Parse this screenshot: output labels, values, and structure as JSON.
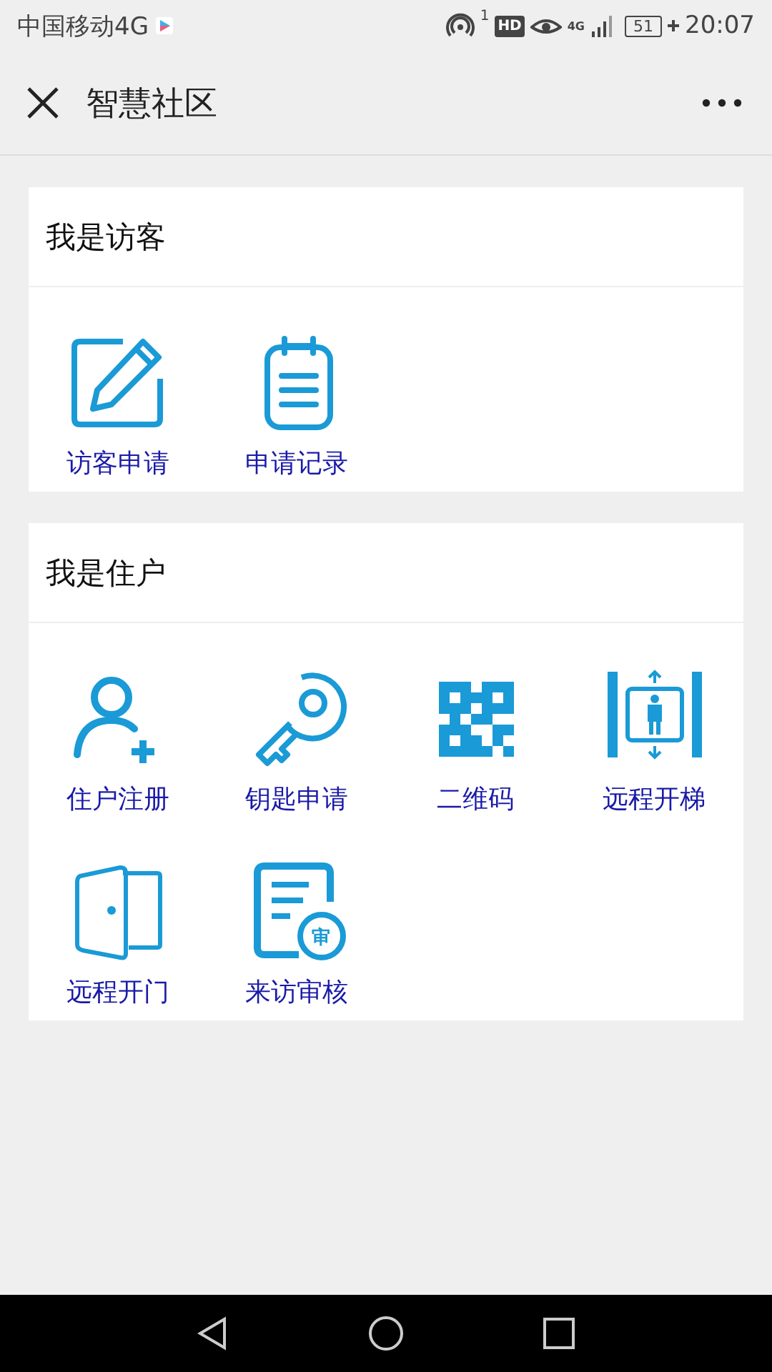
{
  "status_bar": {
    "carrier": "中国移动4G",
    "hotspot_count": "1",
    "hd": "HD",
    "network": "4G",
    "battery": "51",
    "time": "20:07"
  },
  "header": {
    "title": "智慧社区"
  },
  "sections": [
    {
      "title": "我是访客",
      "items": [
        {
          "kind": "edit",
          "label": "访客申请"
        },
        {
          "kind": "notepad",
          "label": "申请记录"
        }
      ]
    },
    {
      "title": "我是住户",
      "items": [
        {
          "kind": "user-add",
          "label": "住户注册"
        },
        {
          "kind": "key",
          "label": "钥匙申请"
        },
        {
          "kind": "qr",
          "label": "二维码"
        },
        {
          "kind": "elevator",
          "label": "远程开梯"
        },
        {
          "kind": "door",
          "label": "远程开门"
        },
        {
          "kind": "review",
          "label": "来访审核",
          "badge": "审"
        }
      ]
    }
  ]
}
